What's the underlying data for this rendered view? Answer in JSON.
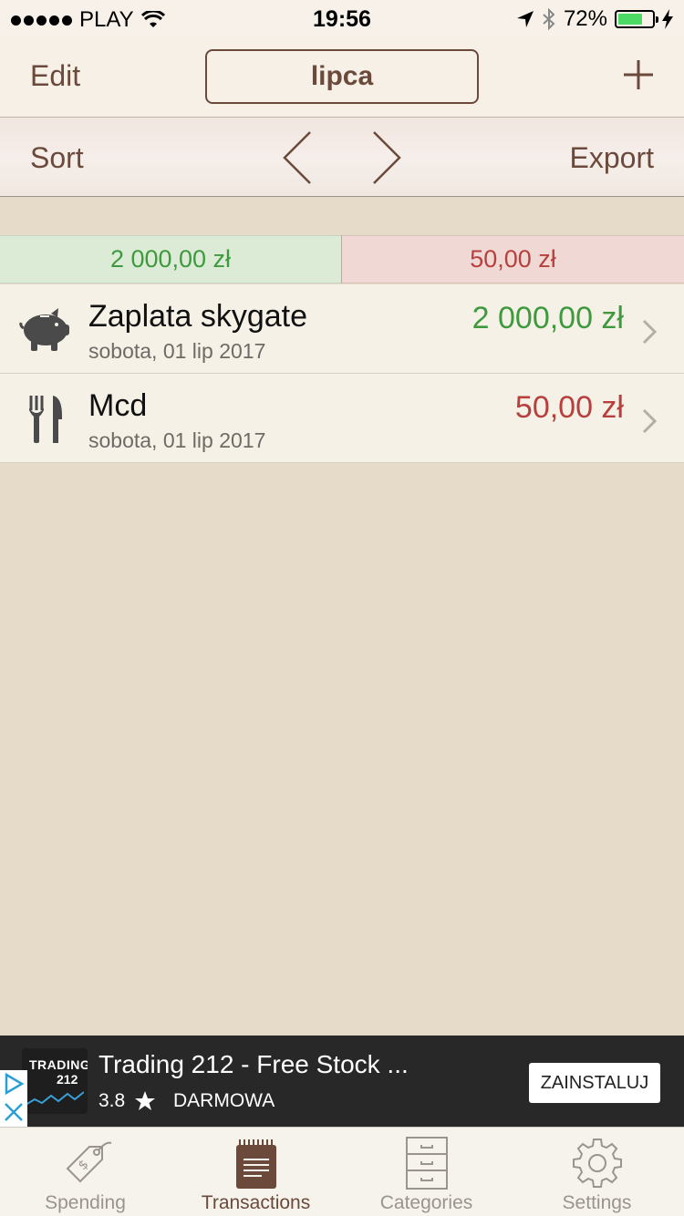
{
  "status_bar": {
    "carrier": "PLAY",
    "time": "19:56",
    "battery": "72%",
    "battery_level": 0.72
  },
  "nav": {
    "edit_label": "Edit",
    "title": "lipca",
    "add_icon": "plus-icon"
  },
  "toolbar": {
    "sort_label": "Sort",
    "export_label": "Export",
    "prev_icon": "chevron-left-icon",
    "next_icon": "chevron-right-icon"
  },
  "totals": {
    "income": "2 000,00 zł",
    "expense": "50,00 zł",
    "income_color": "#3f9a3f",
    "expense_color": "#b7403f"
  },
  "transactions": [
    {
      "title": "Zaplata skygate",
      "date": "sobota, 01 lip 2017",
      "amount": "2 000,00 zł",
      "type": "income",
      "icon": "piggy-bank-icon"
    },
    {
      "title": "Mcd",
      "date": "sobota, 01 lip 2017",
      "amount": "50,00 zł",
      "type": "expense",
      "icon": "fork-knife-icon"
    }
  ],
  "ad": {
    "logo_line1": "TRADING",
    "logo_line2": "212",
    "title": "Trading 212 - Free Stock ...",
    "rating": "3.8",
    "price": "DARMOWA",
    "button": "ZAINSTALUJ"
  },
  "tabs": [
    {
      "label": "Spending",
      "icon": "price-tag-icon",
      "active": false
    },
    {
      "label": "Transactions",
      "icon": "notepad-icon",
      "active": true
    },
    {
      "label": "Categories",
      "icon": "file-cabinet-icon",
      "active": false
    },
    {
      "label": "Settings",
      "icon": "gear-icon",
      "active": false
    }
  ]
}
